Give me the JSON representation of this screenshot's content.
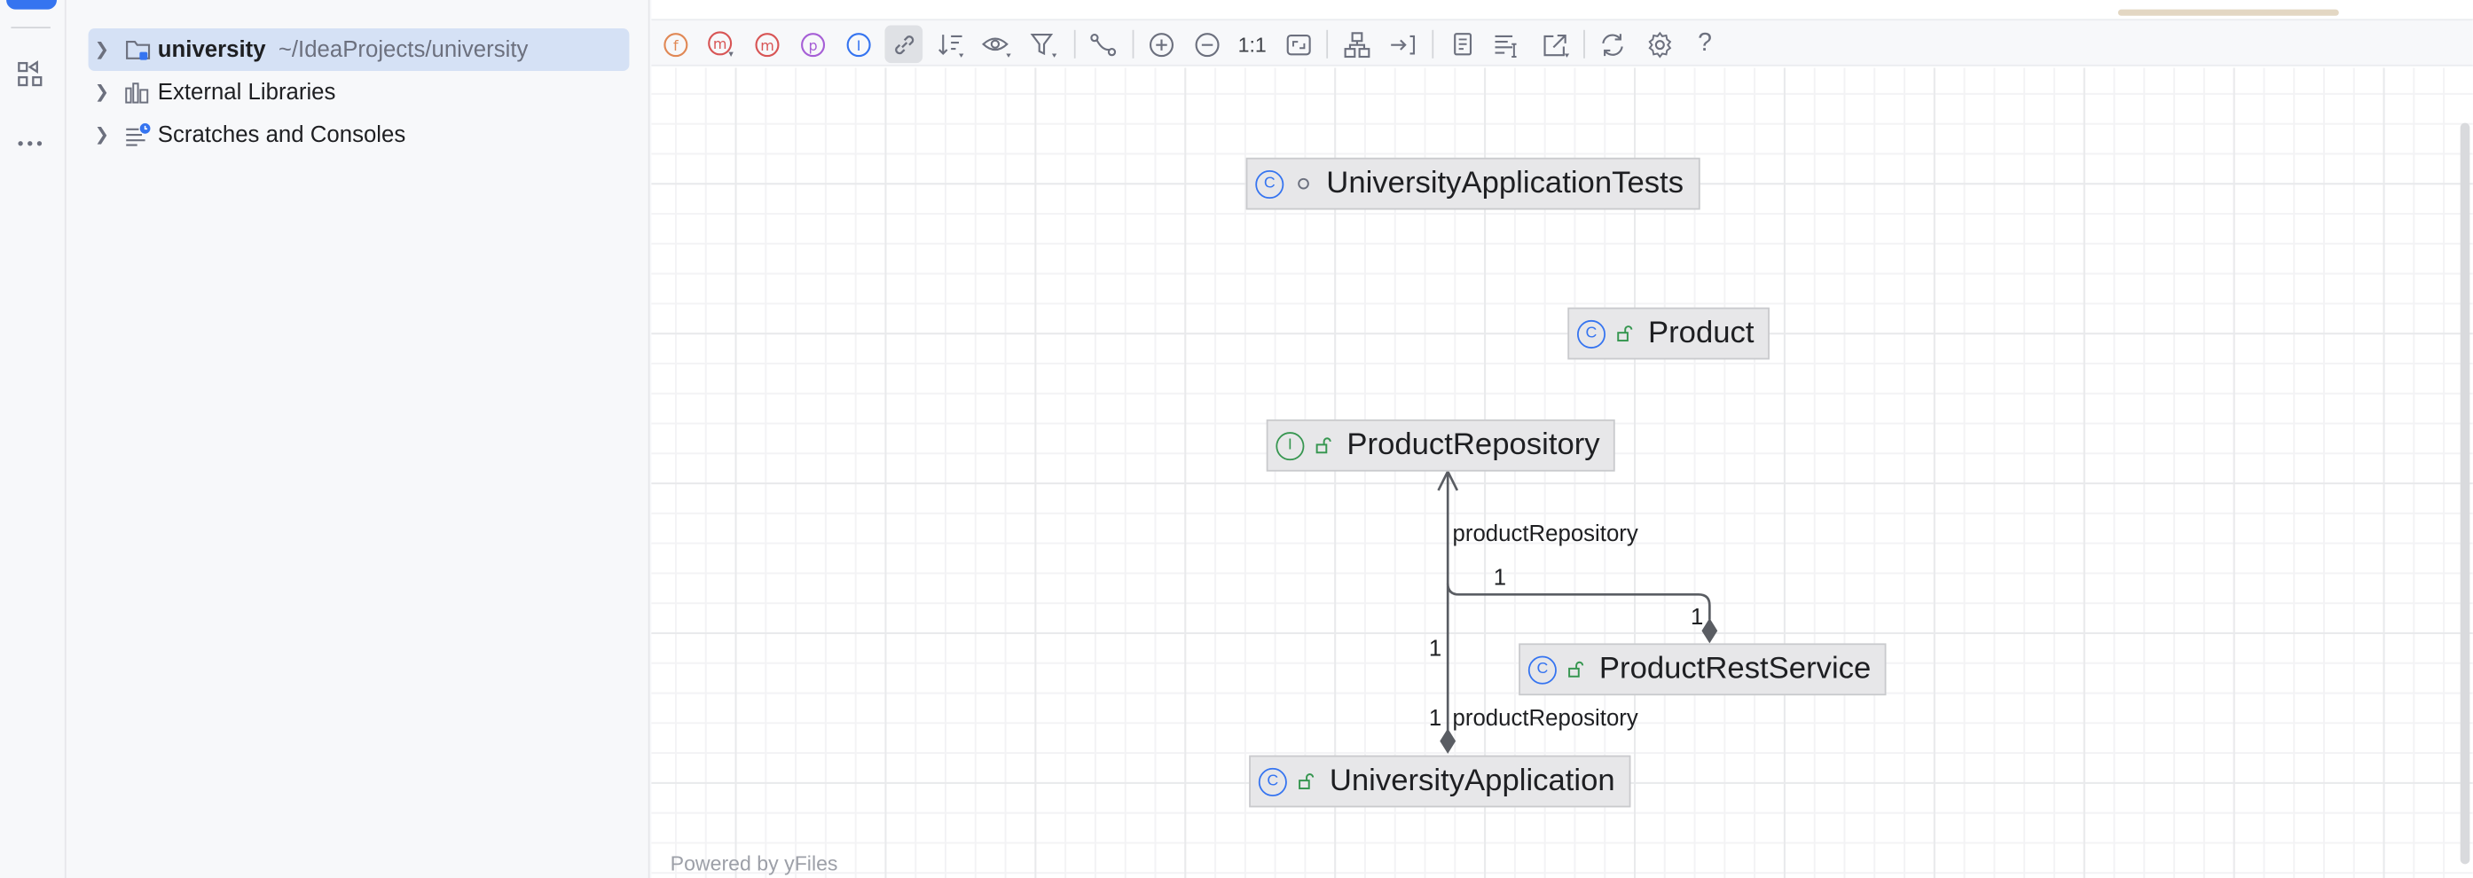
{
  "tool_strip": {
    "icons": [
      "structure-icon",
      "more-icon"
    ]
  },
  "project_tree": {
    "items": [
      {
        "name": "university",
        "path": "~/IdeaProjects/university",
        "icon": "folder-icon",
        "selected": true
      },
      {
        "name": "External Libraries",
        "icon": "library-icon"
      },
      {
        "name": "Scratches and Consoles",
        "icon": "scratches-icon"
      }
    ]
  },
  "toolbar": {
    "zoom_label": "1:1",
    "help_label": "?",
    "buttons": [
      "fields",
      "constructors",
      "methods",
      "properties",
      "inner-classes",
      "dependencies",
      "sort",
      "visibility",
      "filter",
      "routing",
      "zoom-in",
      "zoom-out",
      "actual-size",
      "fit-content",
      "layout",
      "apply-layout",
      "copy",
      "export",
      "open-in-editor",
      "refresh",
      "settings",
      "help"
    ]
  },
  "diagram": {
    "nodes": [
      {
        "id": "tests",
        "name": "UniversityApplicationTests",
        "kind": "class-test",
        "visibility": "package"
      },
      {
        "id": "product",
        "name": "Product",
        "kind": "class",
        "visibility": "public"
      },
      {
        "id": "repo",
        "name": "ProductRepository",
        "kind": "interface",
        "visibility": "public"
      },
      {
        "id": "rest",
        "name": "ProductRestService",
        "kind": "class",
        "visibility": "public"
      },
      {
        "id": "app",
        "name": "UniversityApplication",
        "kind": "class-app",
        "visibility": "public"
      }
    ],
    "edges": [
      {
        "from": "rest",
        "to": "repo",
        "label": "productRepository",
        "source_multiplicity": "1",
        "target_multiplicity": "1"
      },
      {
        "from": "app",
        "to": "repo",
        "label": "productRepository",
        "source_multiplicity": "1",
        "target_multiplicity": "1"
      }
    ],
    "footer": "Powered by yFiles"
  },
  "colors": {
    "accent": "#3574f0",
    "interface": "#369650",
    "node_bg": "#e7e7e9",
    "edge": "#5a5d63"
  }
}
